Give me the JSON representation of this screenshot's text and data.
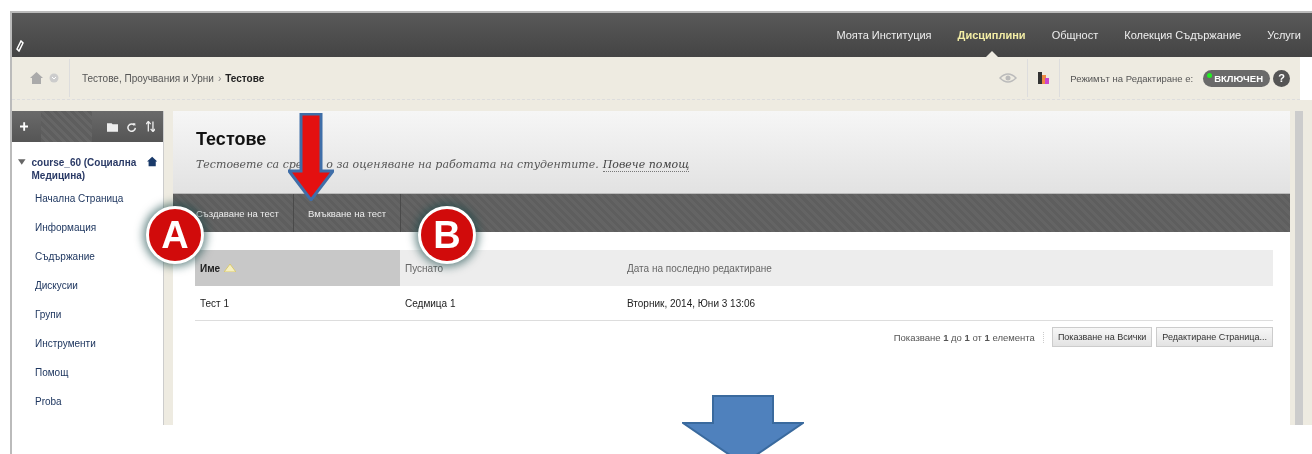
{
  "top_nav": [
    {
      "label": "Моята Институция",
      "selected": false
    },
    {
      "label": "Дисциплини",
      "selected": true
    },
    {
      "label": "Общност",
      "selected": false
    },
    {
      "label": "Колекция Съдържание",
      "selected": false
    },
    {
      "label": "Услуги",
      "selected": false
    }
  ],
  "breadcrumb": {
    "parent": "Тестове, Проучвания и Урни",
    "separator": "›",
    "current": "Тестове"
  },
  "edit_mode": {
    "label": "Режимът на Редактиране е:",
    "value": "ВКЛЮЧЕН",
    "on": true,
    "help": "?"
  },
  "sidebar": {
    "course": {
      "label": "course_60 (Социална Медицина)",
      "expanded": true
    },
    "items": [
      "Начална Страница",
      "Информация",
      "Съдържание",
      "Дискусии",
      "Групи",
      "Инструменти",
      "Помощ",
      "Proba"
    ]
  },
  "page": {
    "title": "Тестове",
    "description_parts": [
      "Тестовете са сре",
      "о за оценяване на работата на студентите."
    ],
    "help_link": "Повече помощ"
  },
  "actions": [
    "Създаване на тест",
    "Вмъкване на тест"
  ],
  "table": {
    "columns": [
      {
        "label": "Име",
        "sorted": true
      },
      {
        "label": "Пуснато",
        "sorted": false
      },
      {
        "label": "Дата на последно редактиране",
        "sorted": false
      }
    ],
    "rows": [
      [
        "Тест 1",
        "Седмица 1",
        "Вторник, 2014, Юни 3 13:06"
      ]
    ]
  },
  "paging": {
    "text": "Показване **1** до **1** от **1** елемента",
    "buttons": [
      "Показване на Всички",
      "Редактиране Страница..."
    ]
  },
  "annotations": [
    {
      "label": "A"
    },
    {
      "label": "B"
    }
  ]
}
